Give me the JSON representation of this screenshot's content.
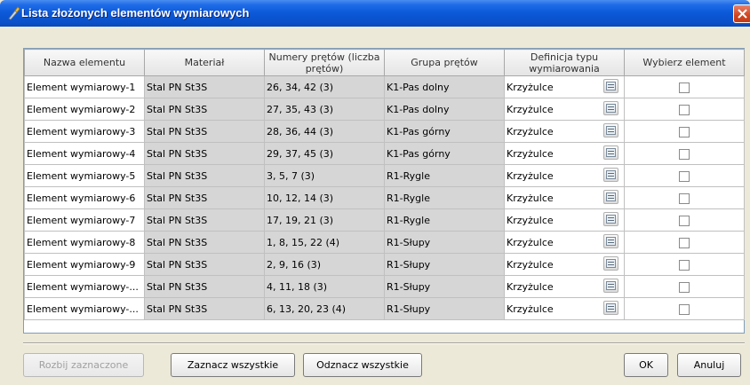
{
  "window": {
    "title": "Lista złożonych elementów wymiarowych"
  },
  "table": {
    "headers": [
      "Nazwa elementu",
      "Materiał",
      "Numery prętów (liczba prętów)",
      "Grupa prętów",
      "Definicja typu wymiarowania",
      "Wybierz element"
    ],
    "rows": [
      {
        "name": "Element wymiarowy-1",
        "material": "Stal PN St3S",
        "bars": "26, 34, 42 (3)",
        "group": "K1-Pas dolny",
        "definition": "Krzyżulce",
        "selected": false
      },
      {
        "name": "Element wymiarowy-2",
        "material": "Stal PN St3S",
        "bars": "27, 35, 43 (3)",
        "group": "K1-Pas dolny",
        "definition": "Krzyżulce",
        "selected": false
      },
      {
        "name": "Element wymiarowy-3",
        "material": "Stal PN St3S",
        "bars": "28, 36, 44 (3)",
        "group": "K1-Pas górny",
        "definition": "Krzyżulce",
        "selected": false
      },
      {
        "name": "Element wymiarowy-4",
        "material": "Stal PN St3S",
        "bars": "29, 37, 45 (3)",
        "group": "K1-Pas górny",
        "definition": "Krzyżulce",
        "selected": false
      },
      {
        "name": "Element wymiarowy-5",
        "material": "Stal PN St3S",
        "bars": "3, 5, 7 (3)",
        "group": "R1-Rygle",
        "definition": "Krzyżulce",
        "selected": false
      },
      {
        "name": "Element wymiarowy-6",
        "material": "Stal PN St3S",
        "bars": "10, 12, 14 (3)",
        "group": "R1-Rygle",
        "definition": "Krzyżulce",
        "selected": false
      },
      {
        "name": "Element wymiarowy-7",
        "material": "Stal PN St3S",
        "bars": "17, 19, 21 (3)",
        "group": "R1-Rygle",
        "definition": "Krzyżulce",
        "selected": false
      },
      {
        "name": "Element wymiarowy-8",
        "material": "Stal PN St3S",
        "bars": "1, 8, 15, 22 (4)",
        "group": "R1-Słupy",
        "definition": "Krzyżulce",
        "selected": false
      },
      {
        "name": "Element wymiarowy-9",
        "material": "Stal PN St3S",
        "bars": "2, 9, 16 (3)",
        "group": "R1-Słupy",
        "definition": "Krzyżulce",
        "selected": false
      },
      {
        "name": "Element wymiarowy-...",
        "material": "Stal PN St3S",
        "bars": "4, 11, 18 (3)",
        "group": "R1-Słupy",
        "definition": "Krzyżulce",
        "selected": false
      },
      {
        "name": "Element wymiarowy-...",
        "material": "Stal PN St3S",
        "bars": "6, 13, 20, 23 (4)",
        "group": "R1-Słupy",
        "definition": "Krzyżulce",
        "selected": false
      }
    ]
  },
  "buttons": {
    "split": "Rozbij zaznaczone",
    "select_all": "Zaznacz wszystkie",
    "deselect_all": "Odznacz wszystkie",
    "ok": "OK",
    "cancel": "Anuluj"
  },
  "colors": {
    "titlebar": "#0b58d8",
    "grey_cell": "#d6d6d6",
    "dialog_bg": "#ece9d8"
  }
}
